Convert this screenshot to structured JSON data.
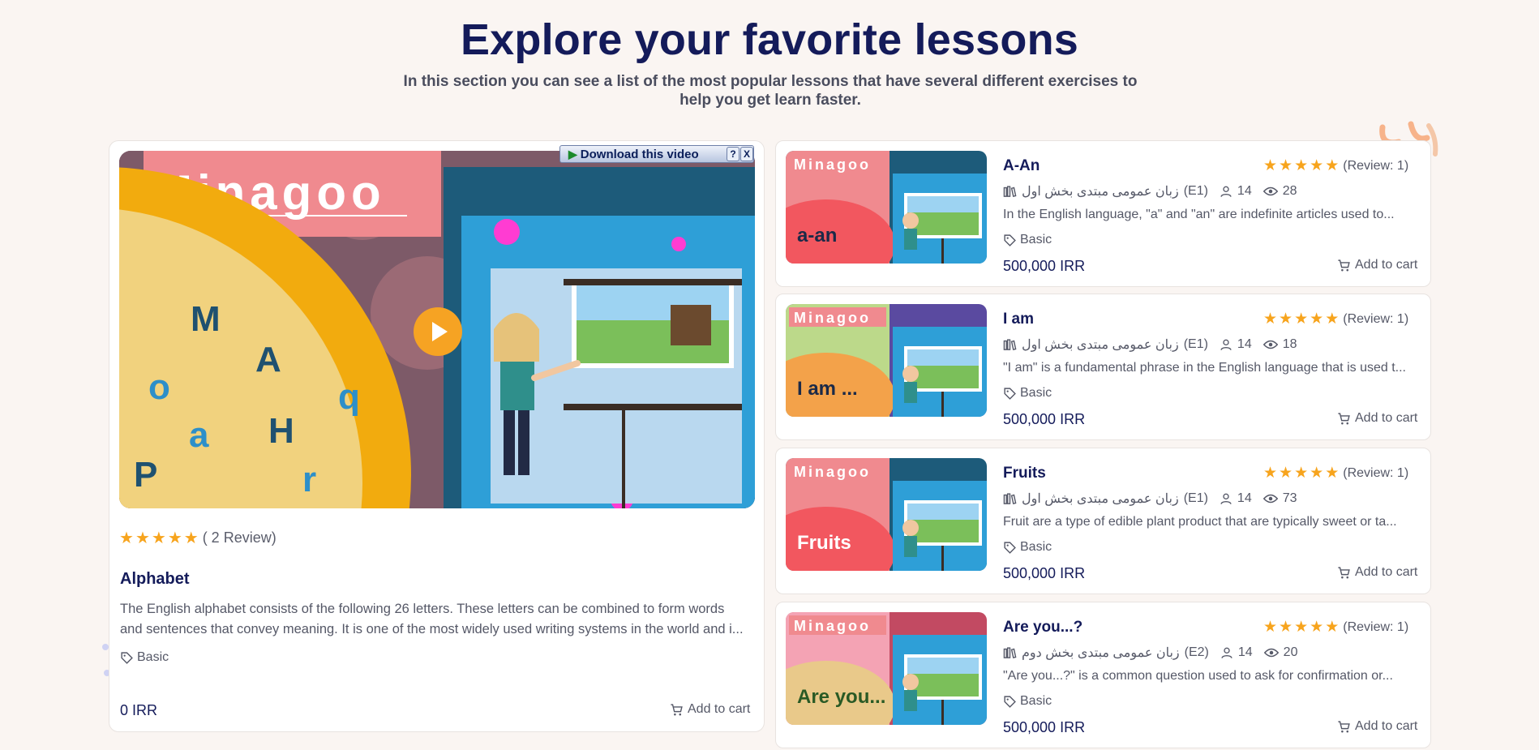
{
  "header": {
    "title": "Explore your favorite lessons",
    "subtitle_line1": "In this section you can see a list of the most popular lessons that have several different exercises to",
    "subtitle_line2": "help you get learn faster."
  },
  "featured": {
    "brand": "Minagoo",
    "download_label": "Download this video",
    "download_help": "?",
    "download_close": "X",
    "letters": [
      "M",
      "A",
      "o",
      "q",
      "a",
      "H",
      "P",
      "r"
    ],
    "rating": 5,
    "review_text": "( 2 Review)",
    "title": "Alphabet",
    "desc_line1": "The English alphabet consists of the following 26 letters. These letters can be combined to form words",
    "desc_line2": "and sentences that convey meaning. It is one of the most widely used writing systems in the world and i...",
    "tag": "Basic",
    "price": "0 IRR",
    "cart_label": "Add to cart"
  },
  "lessons": [
    {
      "title": "A-An",
      "review": "(Review: 1)",
      "category": "زبان عمومی مبتدی بخش اول",
      "level": "(E1)",
      "students": "14",
      "views": "28",
      "desc": "In the English language, \"a\" and \"an\" are indefinite articles used to...",
      "tag": "Basic",
      "price": "500,000 IRR",
      "cart_label": "Add to cart",
      "thumb_brand": "Minagoo",
      "thumb_label": "a-an"
    },
    {
      "title": "I am",
      "review": "(Review: 1)",
      "category": "زبان عمومی مبتدی بخش اول",
      "level": "(E1)",
      "students": "14",
      "views": "18",
      "desc": "\"I am\" is a fundamental phrase in the English language that is used t...",
      "tag": "Basic",
      "price": "500,000 IRR",
      "cart_label": "Add to cart",
      "thumb_brand": "Minagoo",
      "thumb_label": "I am ..."
    },
    {
      "title": "Fruits",
      "review": "(Review: 1)",
      "category": "زبان عمومی مبتدی بخش اول",
      "level": "(E1)",
      "students": "14",
      "views": "73",
      "desc": "Fruit are a type of edible plant product that are typically sweet or ta...",
      "tag": "Basic",
      "price": "500,000 IRR",
      "cart_label": "Add to cart",
      "thumb_brand": "Minagoo",
      "thumb_label": "Fruits"
    },
    {
      "title": "Are you...?",
      "review": "(Review: 1)",
      "category": "زبان عمومی مبتدی بخش دوم",
      "level": "(E2)",
      "students": "14",
      "views": "20",
      "desc": "\"Are you...?\" is a common question used to ask for confirmation or...",
      "tag": "Basic",
      "price": "500,000 IRR",
      "cart_label": "Add to cart",
      "thumb_brand": "Minagoo",
      "thumb_label": "Are you..."
    }
  ],
  "colors": {
    "navy": "#141b5a",
    "star": "#f7a41d",
    "background": "#faf5f2",
    "text_muted": "#555867"
  }
}
